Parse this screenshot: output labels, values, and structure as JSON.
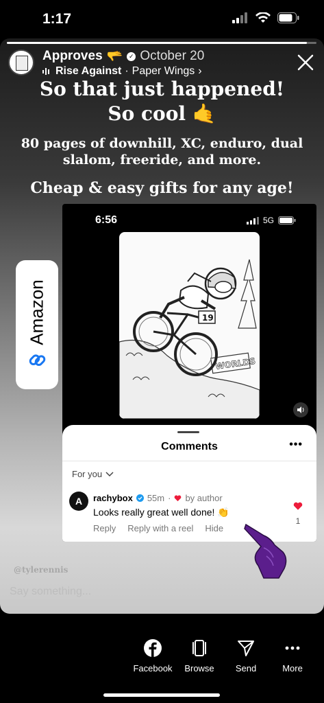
{
  "status_bar": {
    "time": "1:17"
  },
  "story": {
    "progress": 0.97,
    "user": {
      "name": "Approves",
      "name_emoji": "🫳",
      "date": "October 20"
    },
    "music": {
      "artist": "Rise Against",
      "separator": "·",
      "song": "Paper Wings",
      "chevron": "›"
    },
    "headline_line1": "So that just happened!",
    "headline_line2": "So cool 🤙",
    "subtext": "80 pages of downhill, XC, enduro, dual slalom, freeride, and more.",
    "tagline": "Cheap & easy gifts for any age!",
    "link_sticker": {
      "label": "Amazon"
    },
    "embedded_phone": {
      "time": "6:56",
      "network": "5G",
      "coloring_page": {
        "race_plate": "19",
        "banner_text": "WORLDS"
      }
    },
    "comments": {
      "title": "Comments",
      "more": "•••",
      "sort_label": "For you",
      "items": [
        {
          "avatar_letter": "A",
          "username": "rachybox",
          "time": "55m",
          "by_author": "by author",
          "text": "Looks really great well done! 👏",
          "actions": [
            "Reply",
            "Reply with a reel",
            "Hide"
          ],
          "like_count": "1"
        }
      ]
    },
    "mention": "@tylerennis",
    "reply_placeholder": "Say something..."
  },
  "bottom_actions": [
    {
      "label": "Facebook",
      "icon": "facebook-icon"
    },
    {
      "label": "Browse",
      "icon": "browse-icon"
    },
    {
      "label": "Send",
      "icon": "send-icon"
    },
    {
      "label": "More",
      "icon": "more-icon"
    }
  ],
  "colors": {
    "accent_heart": "#ed1c3b",
    "link_blue": "#1877f2",
    "verified_blue": "#1d9bf0",
    "hand_purple": "#5b1e8c"
  }
}
